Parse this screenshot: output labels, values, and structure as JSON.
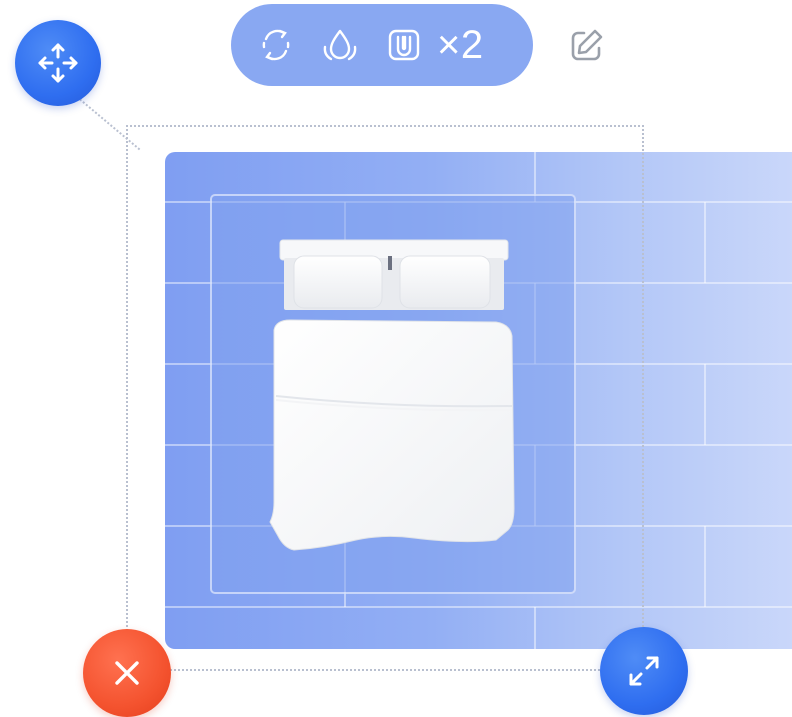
{
  "toolbar": {
    "tools": [
      {
        "name": "rotate",
        "icon": "rotate-icon"
      },
      {
        "name": "material",
        "icon": "material-drop-icon"
      },
      {
        "name": "magnet",
        "icon": "magnet-icon"
      }
    ],
    "count_label": "×2",
    "edit_icon": "edit-icon"
  },
  "handles": {
    "move_icon": "move-arrows-icon",
    "delete_icon": "close-icon",
    "resize_icon": "resize-arrows-icon"
  },
  "colors": {
    "toolbar_bg": "#89a8f2",
    "handle_blue": "#2f6ef0",
    "handle_red": "#f4532f",
    "floor_blue": "#7f9ef2",
    "edit_icon": "#9aa0aa",
    "selection_dots": "#b9c0d0"
  },
  "scene": {
    "object": "double-bed"
  }
}
